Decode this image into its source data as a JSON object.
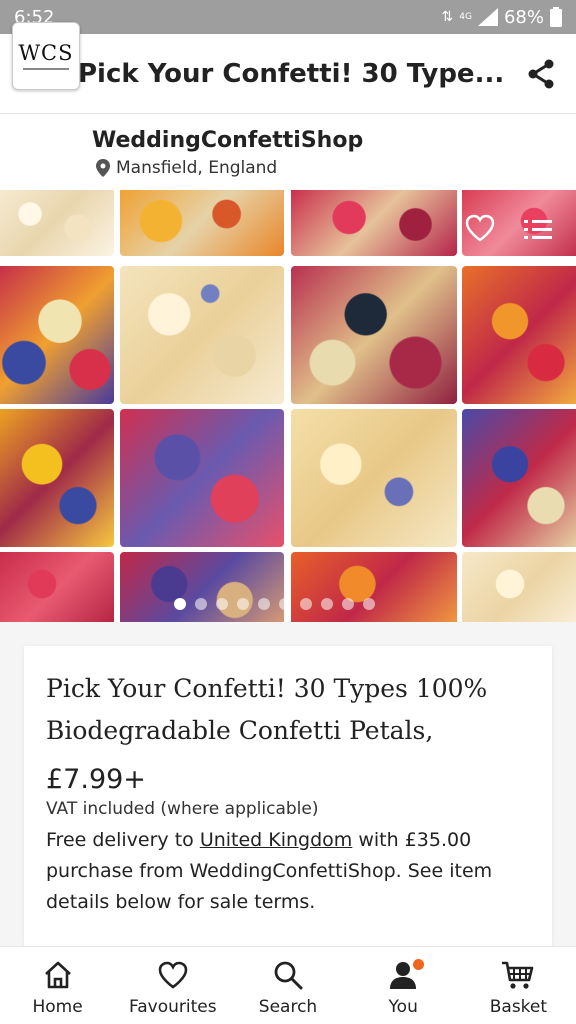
{
  "status_bar": {
    "time": "6:52",
    "network": "4G",
    "battery": "68%"
  },
  "app_bar": {
    "title": "Pick Your Confetti! 30 Type..."
  },
  "shop": {
    "logo_text": "WCS",
    "name": "WeddingConfettiShop",
    "location": "Mansfield, England"
  },
  "gallery": {
    "image_count": 10,
    "active_index": 0
  },
  "listing": {
    "title": "Pick Your Confetti! 30 Types 100% Biodegradable Confetti Petals, Natural ...",
    "price": "£7.99+",
    "vat": "VAT included (where applicable)",
    "delivery_prefix": "Free delivery to ",
    "delivery_link": "United Kingdom",
    "delivery_suffix": " with £35.00 purchase from WeddingConfettiShop. See item details below for sale terms."
  },
  "bottom_nav": {
    "items": [
      {
        "label": "Home",
        "icon": "home-icon"
      },
      {
        "label": "Favourites",
        "icon": "heart-icon"
      },
      {
        "label": "Search",
        "icon": "search-icon"
      },
      {
        "label": "You",
        "icon": "person-icon"
      },
      {
        "label": "Basket",
        "icon": "basket-icon"
      }
    ]
  },
  "colors": {
    "accent": "#f1641e",
    "status_bar": "#9e9e9e"
  }
}
